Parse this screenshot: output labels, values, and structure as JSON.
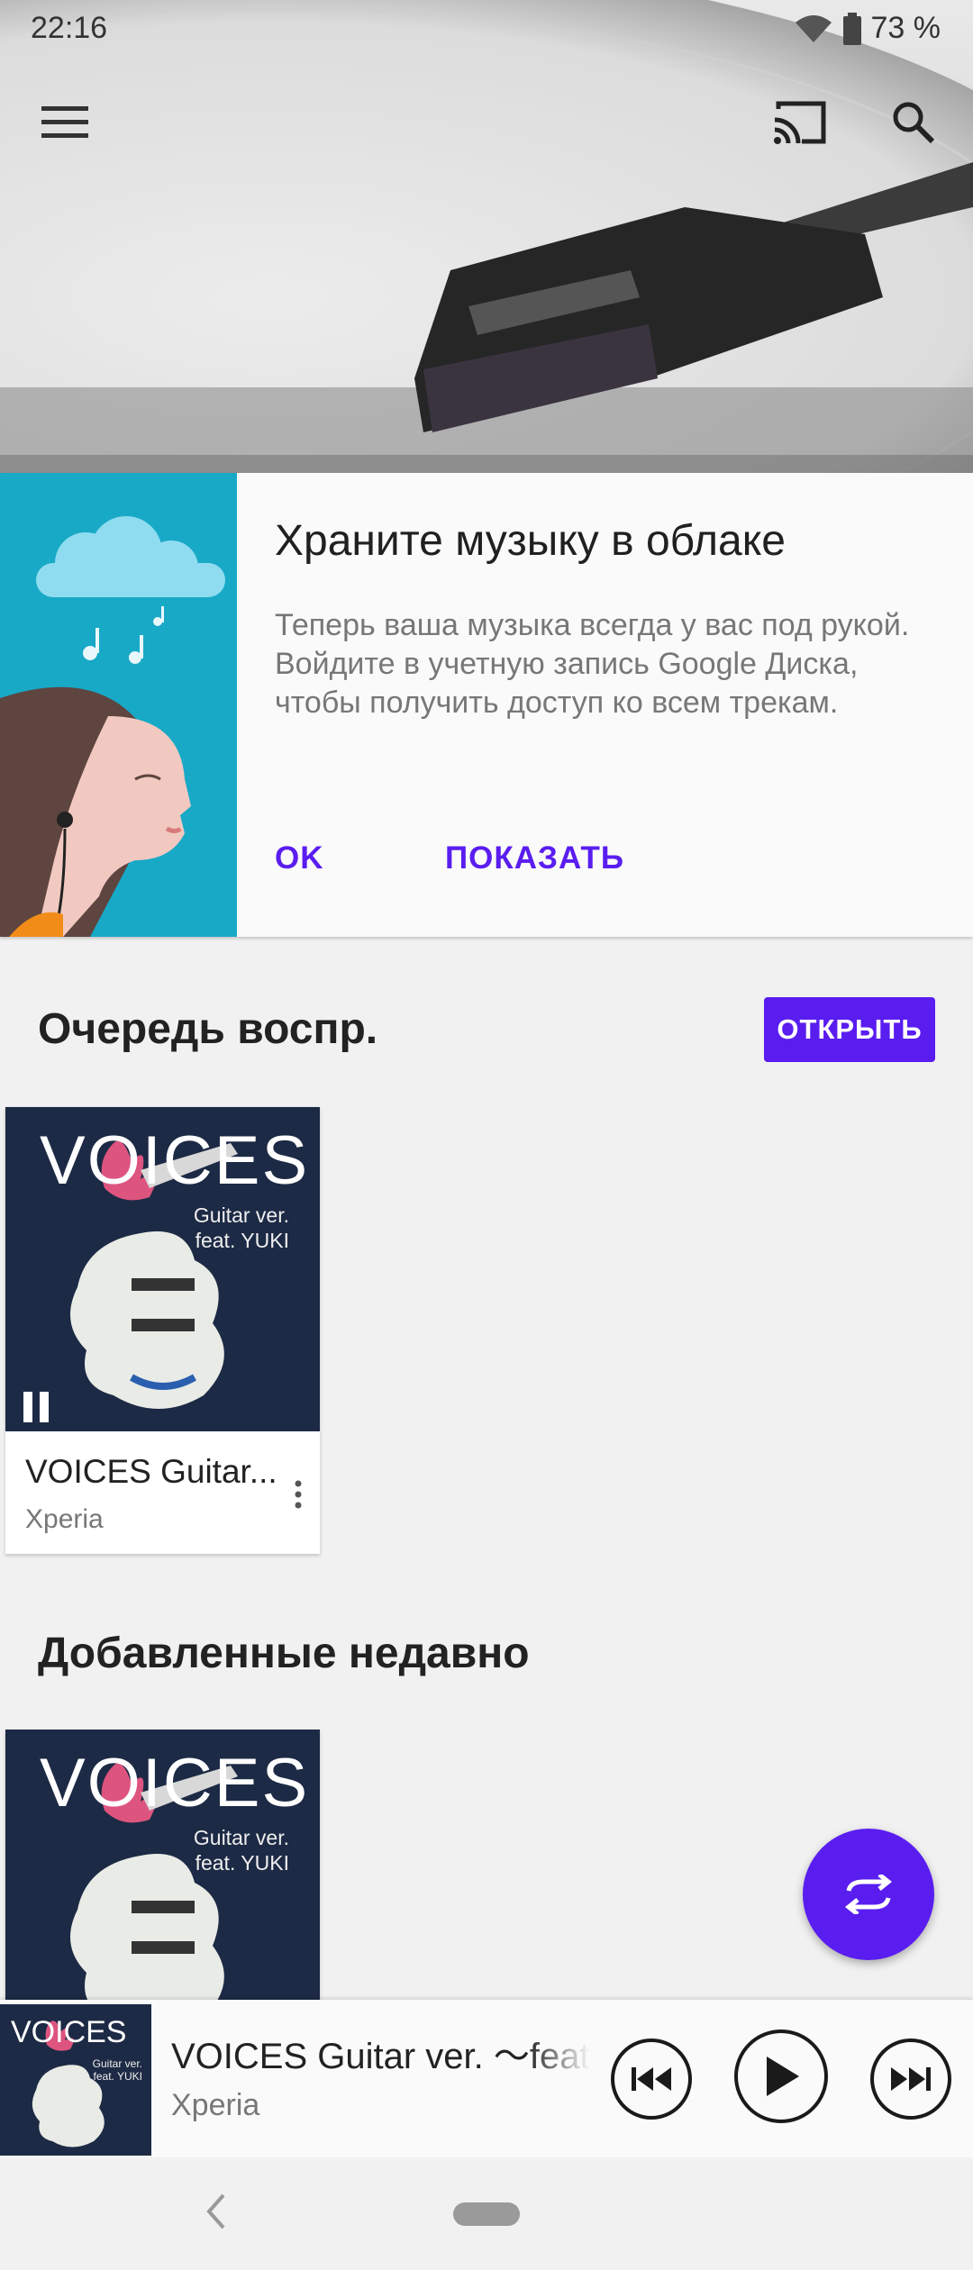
{
  "status_bar": {
    "time": "22:16",
    "battery": "73 %"
  },
  "icons": {
    "menu": "menu-icon",
    "cast": "cast-icon",
    "search": "search-icon",
    "more": "more-vert-icon",
    "pause": "pause-icon",
    "fab": "swap-icon",
    "prev": "skip-previous-icon",
    "play": "play-icon",
    "next": "skip-next-icon",
    "back": "back-icon",
    "home": "home-pill"
  },
  "promo": {
    "title": "Храните музыку в облаке",
    "body": "Теперь ваша музыка всегда у вас под рукой. Войдите в учетную запись Google Диска, чтобы получить доступ ко всем трекам.",
    "ok_label": "OK",
    "show_label": "ПОКАЗАТЬ"
  },
  "queue": {
    "title": "Очередь воспр.",
    "open_label": "ОТКРЫТЬ",
    "card": {
      "title": "VOICES Guitar...",
      "artist": "Xperia",
      "art_word": "VOICES",
      "art_sub_1": "Guitar ver.",
      "art_sub_2": "feat. YUKI"
    }
  },
  "recent": {
    "title": "Добавленные недавно",
    "card": {
      "art_word": "VOICES",
      "art_sub_1": "Guitar ver.",
      "art_sub_2": "feat. YUKI"
    }
  },
  "player": {
    "title": "VOICES Guitar ver. 〜feat. YUKI〜",
    "artist": "Xperia",
    "art_word": "VOICES",
    "art_sub_1": "Guitar ver.",
    "art_sub_2": "feat. YUKI"
  },
  "colors": {
    "accent": "#5a1df0",
    "promo_art_bg": "#18a9c7",
    "album_bg": "#1d2a45"
  }
}
